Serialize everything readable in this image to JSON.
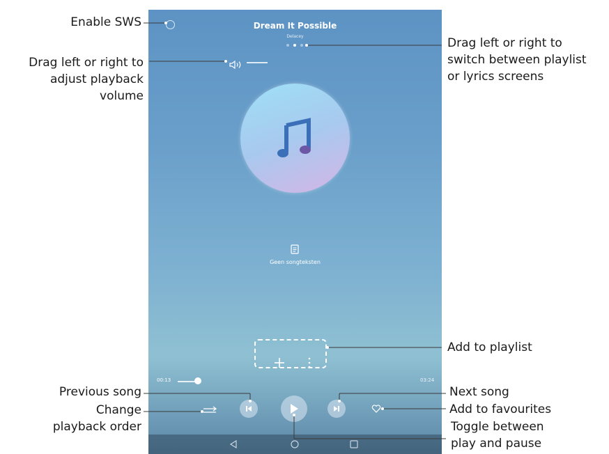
{
  "player": {
    "song_title": "Dream It Possible",
    "artist": "Delacey",
    "lyrics_status": "Geen songteksten",
    "time_elapsed": "00:13",
    "time_total": "03:24",
    "progress_fraction": 0.064,
    "volume_fraction": 0.0,
    "page_count": 3,
    "current_page": 2
  },
  "icons": {
    "sws": "sws-toggle-icon",
    "volume": "speaker-icon",
    "album": "music-note-icon",
    "lyrics": "lyrics-document-icon",
    "add": "plus-icon",
    "more": "vertical-dots-icon",
    "order": "shuffle-icon",
    "previous": "skip-previous-icon",
    "play": "play-icon",
    "next": "skip-next-icon",
    "favourite": "heart-icon",
    "nav_back": "triangle-back-icon",
    "nav_home": "circle-home-icon",
    "nav_recent": "square-recent-icon"
  },
  "colors": {
    "accent": "#ffffff",
    "screen_top": "#5d93c4",
    "screen_bottom": "#5b86a3",
    "album_gradient_start": "#9ee0f6",
    "album_gradient_end": "#d4b5e6",
    "note_color": "#3b6fb7"
  },
  "annotations": {
    "enable_sws": "Enable SWS",
    "volume_line1": "Drag left or right to",
    "volume_line2": "adjust playback",
    "volume_line3": "volume",
    "switch_line1": "Drag left or right to",
    "switch_line2": "switch between playlist",
    "switch_line3": "or lyrics screens",
    "add_to_playlist": "Add to playlist",
    "previous_song": "Previous song",
    "change_order_line1": "Change",
    "change_order_line2": "playback order",
    "next_song": "Next song",
    "add_to_favourites": "Add to favourites",
    "toggle_line1": "Toggle between",
    "toggle_line2": "play and pause"
  }
}
